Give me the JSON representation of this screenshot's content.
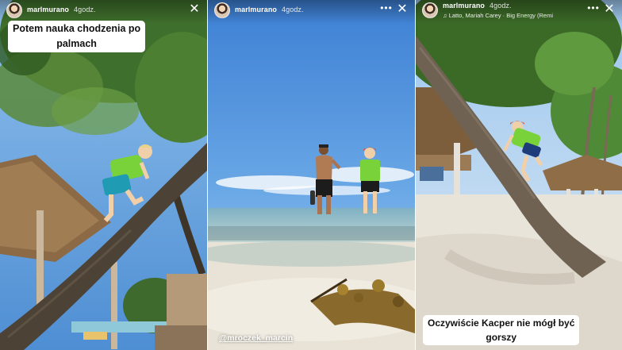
{
  "stories": [
    {
      "username": "marlmurano",
      "time": "4godz.",
      "caption_line1": "Potem nauka chodzenia po",
      "caption_line2": "palmach",
      "close_icon": "close-icon"
    },
    {
      "username": "marlmurano",
      "time": "4godz.",
      "mention": "@mroczek_marcin",
      "more_icon": "more-options-icon",
      "close_icon": "close-icon"
    },
    {
      "username": "marlmurano",
      "time": "4godz.",
      "music": "♫ Latto, Mariah Carey · Big Energy (Remi",
      "caption_line1": "Oczywiście Kacper nie mógł być",
      "caption_line2": "gorszy",
      "more_icon": "more-options-icon",
      "close_icon": "close-icon"
    }
  ],
  "colors": {
    "sky_blue": "#5a9bd8",
    "sea": "#9fcbd0",
    "sand": "#efe6d8",
    "kid_shirt": "#7ad23a"
  }
}
